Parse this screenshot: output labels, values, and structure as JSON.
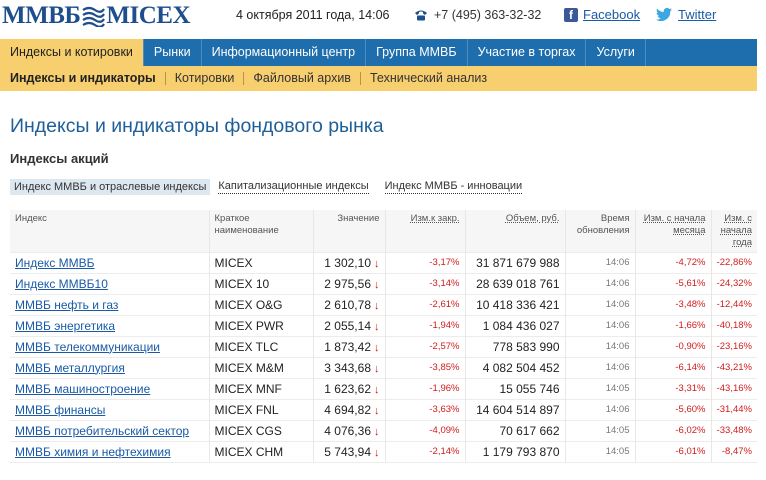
{
  "header": {
    "logo_left": "ММВБ",
    "logo_right": "MICEX",
    "date": "4 октября 2011 года, 14:06",
    "phone": "+7 (495) 363-32-32",
    "facebook": "Facebook",
    "twitter": "Twitter"
  },
  "nav": {
    "items": [
      {
        "label": "Индексы и котировки"
      },
      {
        "label": "Рынки"
      },
      {
        "label": "Информационный центр"
      },
      {
        "label": "Группа ММВБ"
      },
      {
        "label": "Участие в торгах"
      },
      {
        "label": "Услуги"
      }
    ]
  },
  "subnav": {
    "items": [
      {
        "label": "Индексы и индикаторы"
      },
      {
        "label": "Котировки"
      },
      {
        "label": "Файловый архив"
      },
      {
        "label": "Технический анализ"
      }
    ]
  },
  "page": {
    "title": "Индексы и индикаторы фондового рынка",
    "section_title": "Индексы акций"
  },
  "tabs": [
    {
      "label": "Индекс ММВБ и отраслевые индексы"
    },
    {
      "label": "Капитализационные индексы"
    },
    {
      "label": "Индекс ММВБ - инновации"
    }
  ],
  "table": {
    "headers": {
      "index": "Индекс",
      "short": "Краткое наименование",
      "value": "Значение",
      "change": "Изм.к закр.",
      "volume": "Объем, руб.",
      "time": "Время обновления",
      "month": "Изм. с начала месяца",
      "year": "Изм. с начала года"
    },
    "rows": [
      {
        "name": "Индекс ММВБ",
        "short": "MICEX",
        "value": "1 302,10",
        "change": "-3,17%",
        "volume": "31 871 679 988",
        "time": "14:06",
        "month": "-4,72%",
        "year": "-22,86%"
      },
      {
        "name": "Индекс ММВБ10",
        "short": "MICEX 10",
        "value": "2 975,56",
        "change": "-3,14%",
        "volume": "28 639 018 761",
        "time": "14:06",
        "month": "-5,61%",
        "year": "-24,32%"
      },
      {
        "name": "ММВБ нефть и газ",
        "short": "MICEX O&G",
        "value": "2 610,78",
        "change": "-2,61%",
        "volume": "10 418 336 421",
        "time": "14:06",
        "month": "-3,48%",
        "year": "-12,44%"
      },
      {
        "name": "ММВБ энергетика",
        "short": "MICEX PWR",
        "value": "2 055,14",
        "change": "-1,94%",
        "volume": "1 084 436 027",
        "time": "14:06",
        "month": "-1,66%",
        "year": "-40,18%"
      },
      {
        "name": "ММВБ телекоммуникации",
        "short": "MICEX TLC",
        "value": "1 873,42",
        "change": "-2,57%",
        "volume": "778 583 990",
        "time": "14:06",
        "month": "-0,90%",
        "year": "-23,16%"
      },
      {
        "name": "ММВБ металлургия",
        "short": "MICEX M&M",
        "value": "3 343,68",
        "change": "-3,85%",
        "volume": "4 082 504 452",
        "time": "14:06",
        "month": "-6,14%",
        "year": "-43,21%"
      },
      {
        "name": "ММВБ машиностроение",
        "short": "MICEX MNF",
        "value": "1 623,62",
        "change": "-1,96%",
        "volume": "15 055 746",
        "time": "14:05",
        "month": "-3,31%",
        "year": "-43,16%"
      },
      {
        "name": "ММВБ финансы",
        "short": "MICEX FNL",
        "value": "4 694,82",
        "change": "-3,63%",
        "volume": "14 604 514 897",
        "time": "14:06",
        "month": "-5,60%",
        "year": "-31,44%"
      },
      {
        "name": "ММВБ потребительский сектор",
        "short": "MICEX CGS",
        "value": "4 076,36",
        "change": "-4,09%",
        "volume": "70 617 662",
        "time": "14:05",
        "month": "-6,02%",
        "year": "-33,48%"
      },
      {
        "name": "ММВБ химия и нефтехимия",
        "short": "MICEX CHM",
        "value": "5 743,94",
        "change": "-2,14%",
        "volume": "1 179 793 870",
        "time": "14:05",
        "month": "-6,01%",
        "year": "-8,47%"
      }
    ]
  }
}
